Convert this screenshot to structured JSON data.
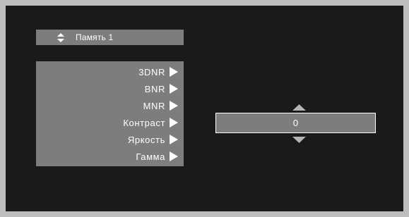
{
  "memory": {
    "label": "Память 1",
    "icon": "up-down-arrows-icon"
  },
  "menu": {
    "items": [
      {
        "label": "3DNR",
        "icon": "arrow-right-icon"
      },
      {
        "label": "BNR",
        "icon": "arrow-right-icon"
      },
      {
        "label": "MNR",
        "icon": "arrow-right-icon"
      },
      {
        "label": "Контраст",
        "icon": "arrow-right-icon"
      },
      {
        "label": "Яркость",
        "icon": "arrow-right-icon"
      },
      {
        "label": "Гамма",
        "icon": "arrow-right-icon"
      }
    ]
  },
  "adjust": {
    "value": "0",
    "up_icon": "triangle-up-icon",
    "down_icon": "triangle-down-icon"
  },
  "colors": {
    "background": "#1b1919",
    "frame": "#bdbdbd",
    "panel": "#7d7d7d",
    "text": "#ffffff",
    "arrow_gray": "#b4b4b4"
  }
}
